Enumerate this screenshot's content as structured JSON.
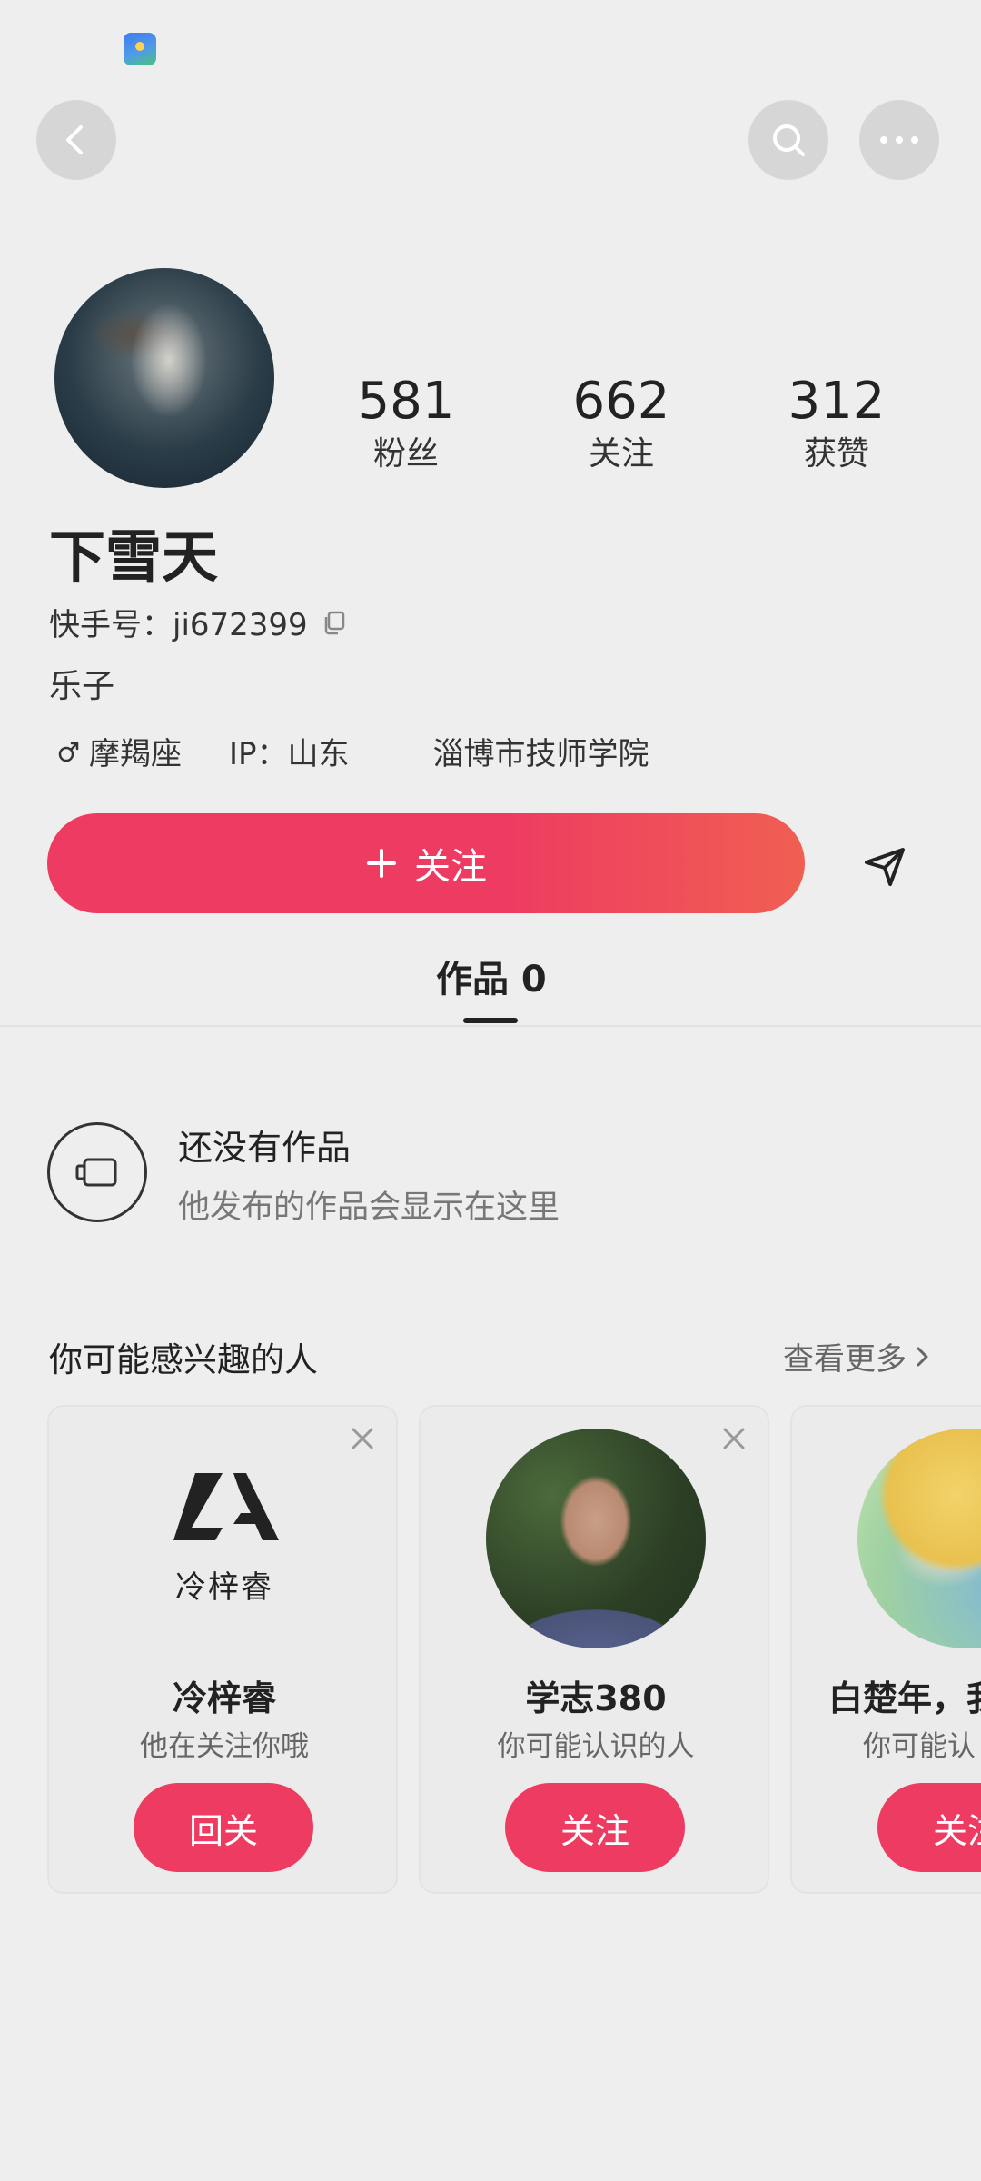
{
  "stats": {
    "fans": {
      "value": "581",
      "label": "粉丝"
    },
    "following": {
      "value": "662",
      "label": "关注"
    },
    "likes": {
      "value": "312",
      "label": "获赞"
    }
  },
  "profile": {
    "name": "下雪天",
    "kuaishou_id": "快手号：ji672399",
    "bio": "乐子",
    "zodiac": "摩羯座",
    "ip": "IP：山东",
    "school": "淄博市技师学院"
  },
  "actions": {
    "follow_label": "关注"
  },
  "tabs": {
    "works_label": "作品 0"
  },
  "empty_state": {
    "title": "还没有作品",
    "subtitle": "他发布的作品会显示在这里"
  },
  "recommend": {
    "title": "你可能感兴趣的人",
    "more": "查看更多",
    "cards": [
      {
        "avatar_text": "冷梓睿",
        "name": "冷梓睿",
        "reason": "他在关注你哦",
        "button": "回关"
      },
      {
        "name": "学志380",
        "reason": "你可能认识的人",
        "button": "关注"
      },
      {
        "name": "白楚年，我",
        "reason": "你可能认",
        "button": "关注"
      }
    ]
  },
  "colors": {
    "accent": "#ee3b61",
    "background": "#eeeeee"
  }
}
